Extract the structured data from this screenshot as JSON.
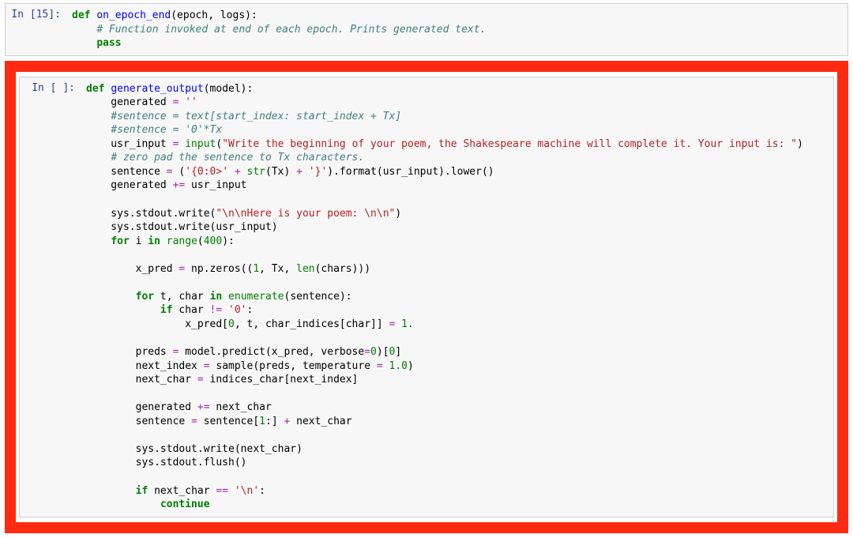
{
  "cells": [
    {
      "prompt_prefix": "In [",
      "prompt_number": "15",
      "prompt_suffix": "]:",
      "code_html": "<span class='kw'>def</span> <span class='fn'>on_epoch_end</span>(epoch, logs):\n    <span class='cm'># Function invoked at end of each epoch. Prints generated text.</span>\n    <span class='kw'>pass</span>"
    },
    {
      "highlighted": true,
      "prompt_prefix": "In [",
      "prompt_number": " ",
      "prompt_suffix": "]:",
      "code_html": "<span class='kw'>def</span> <span class='fn'>generate_output</span>(model):\n    generated <span class='op'>=</span> <span class='st'>''</span>\n    <span class='cm'>#sentence = text[start_index: start_index + Tx]</span>\n    <span class='cm'>#sentence = '0'*Tx</span>\n    usr_input <span class='op'>=</span> <span class='bi'>input</span>(<span class='st'>\"Write the beginning of your poem, the Shakespeare machine will complete it. Your input is: \"</span>)\n    <span class='cm'># zero pad the sentence to Tx characters.</span>\n    sentence <span class='op'>=</span> (<span class='st'>'{0:0>'</span> <span class='op'>+</span> <span class='bi'>str</span>(Tx) <span class='op'>+</span> <span class='st'>'}'</span>).format(usr_input).lower()\n    generated <span class='op'>+=</span> usr_input\n\n    sys.stdout.write(<span class='st'>\"\\n\\nHere is your poem: \\n\\n\"</span>)\n    sys.stdout.write(usr_input)\n    <span class='kw'>for</span> i <span class='kw'>in</span> <span class='bi'>range</span>(<span class='num-lit'>400</span>):\n\n        x_pred <span class='op'>=</span> np.zeros((<span class='num-lit'>1</span>, Tx, <span class='bi'>len</span>(chars)))\n\n        <span class='kw'>for</span> t, char <span class='kw'>in</span> <span class='bi'>enumerate</span>(sentence):\n            <span class='kw'>if</span> char <span class='op'>!=</span> <span class='st'>'0'</span>:\n                x_pred[<span class='num-lit'>0</span>, t, char_indices[char]] <span class='op'>=</span> <span class='num-lit'>1.</span>\n\n        preds <span class='op'>=</span> model.predict(x_pred, verbose<span class='op'>=</span><span class='num-lit'>0</span>)[<span class='num-lit'>0</span>]\n        next_index <span class='op'>=</span> sample(preds, temperature <span class='op'>=</span> <span class='num-lit'>1.0</span>)\n        next_char <span class='op'>=</span> indices_char[next_index]\n\n        generated <span class='op'>+=</span> next_char\n        sentence <span class='op'>=</span> sentence[<span class='num-lit'>1</span>:] <span class='op'>+</span> next_char\n\n        sys.stdout.write(next_char)\n        sys.stdout.flush()\n\n        <span class='kw'>if</span> next_char <span class='op'>==</span> <span class='st'>'\\n'</span>:\n            <span class='kw'>continue</span>"
    }
  ]
}
